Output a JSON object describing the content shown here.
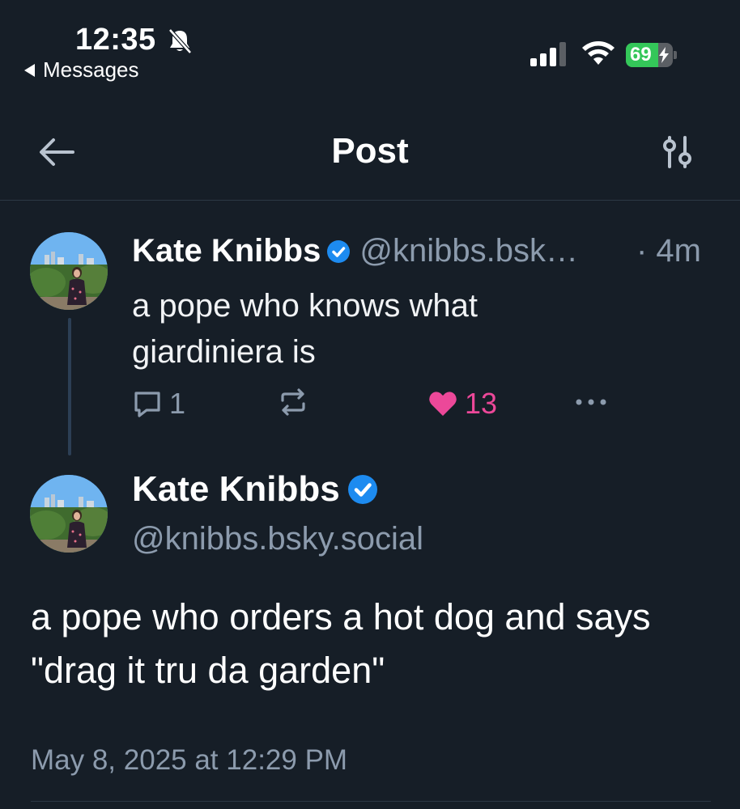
{
  "status_bar": {
    "time": "12:35",
    "back_app_label": "Messages",
    "battery_percent": "69",
    "battery_level": 0.69
  },
  "header": {
    "title": "Post"
  },
  "parent_post": {
    "author_name": "Kate Knibbs",
    "handle": "@knibbs.bsk…",
    "time_ago": "· 4m",
    "text": "a pope who knows what giardiniera is",
    "reply_count": "1",
    "like_count": "13"
  },
  "main_post": {
    "author_name": "Kate Knibbs",
    "handle": "@knibbs.bsky.social",
    "text": "a pope who orders a hot dog and says \"drag it tru da garden\"",
    "date": "May 8, 2025 at 12:29 PM"
  },
  "colors": {
    "background": "#161e27",
    "secondary_text": "#8c9bad",
    "verified_blue": "#1d8bf0",
    "like_pink": "#ec4899"
  }
}
